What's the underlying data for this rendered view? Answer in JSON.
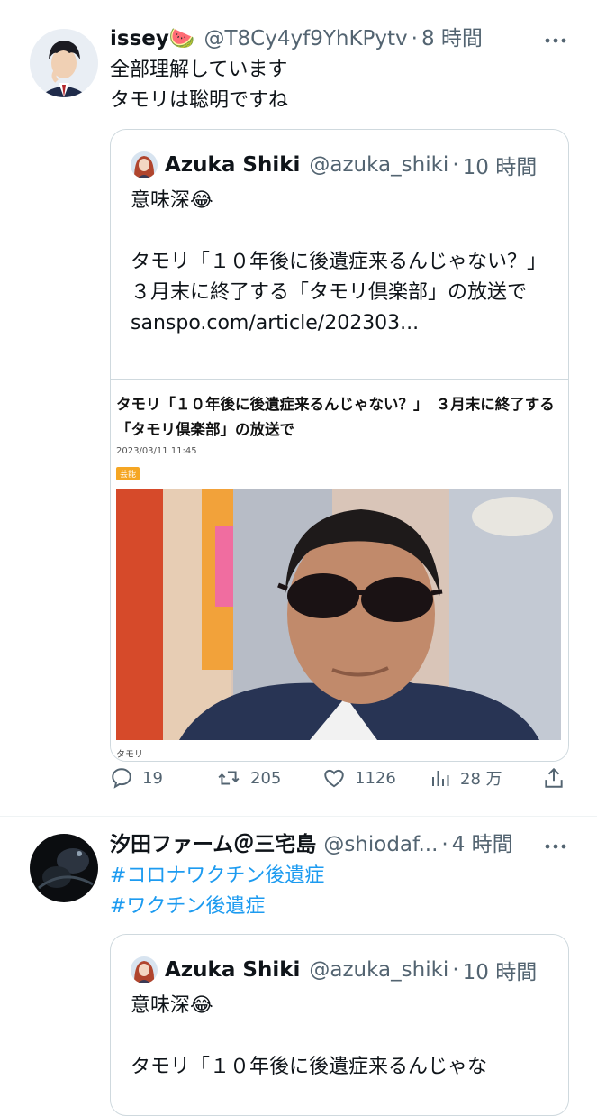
{
  "tweets": [
    {
      "name": "issey🍉",
      "handle": "@T8Cy4yf9YhKPytv",
      "separator": "·",
      "time": "8 時間",
      "body_lines": [
        "全部理解しています",
        "タモリは聡明ですね"
      ],
      "quote": {
        "name": "Azuka Shiki",
        "handle": "@azuka_shiki",
        "separator": "·",
        "time": "10 時間",
        "text": "意味深😂\n\nタモリ「１０年後に後遺症来るんじゃない？」　３月末に終了する「タモリ倶楽部」の放送で\nsanspo.com/article/202303...",
        "card": {
          "title": "タモリ「１０年後に後遺症来るんじゃない？」　３月末に終了する「タモリ倶楽部」の放送で",
          "date": "2023/03/11 11:45",
          "tag": "芸能",
          "caption": "タモリ"
        }
      },
      "actions": {
        "replies": "19",
        "retweets": "205",
        "likes": "1126",
        "views": "28 万"
      }
    },
    {
      "name": "汐田ファーム＠三宅島",
      "handle": "@shiodaf...",
      "separator": "·",
      "time": "4 時間",
      "hashtags": [
        "#コロナワクチン後遺症",
        "#ワクチン後遺症"
      ],
      "quote": {
        "name": "Azuka Shiki",
        "handle": "@azuka_shiki",
        "separator": "·",
        "time": "10 時間",
        "text": "意味深😂\n\nタモリ「１０年後に後遺症来るんじゃな"
      }
    }
  ],
  "colors": {
    "link": "#1d9bf0",
    "secondary_text": "#536471",
    "border": "#cfd9de",
    "tag": "#f5a623"
  },
  "icons": [
    "more-icon",
    "reply-icon",
    "retweet-icon",
    "like-icon",
    "views-icon",
    "share-icon"
  ]
}
